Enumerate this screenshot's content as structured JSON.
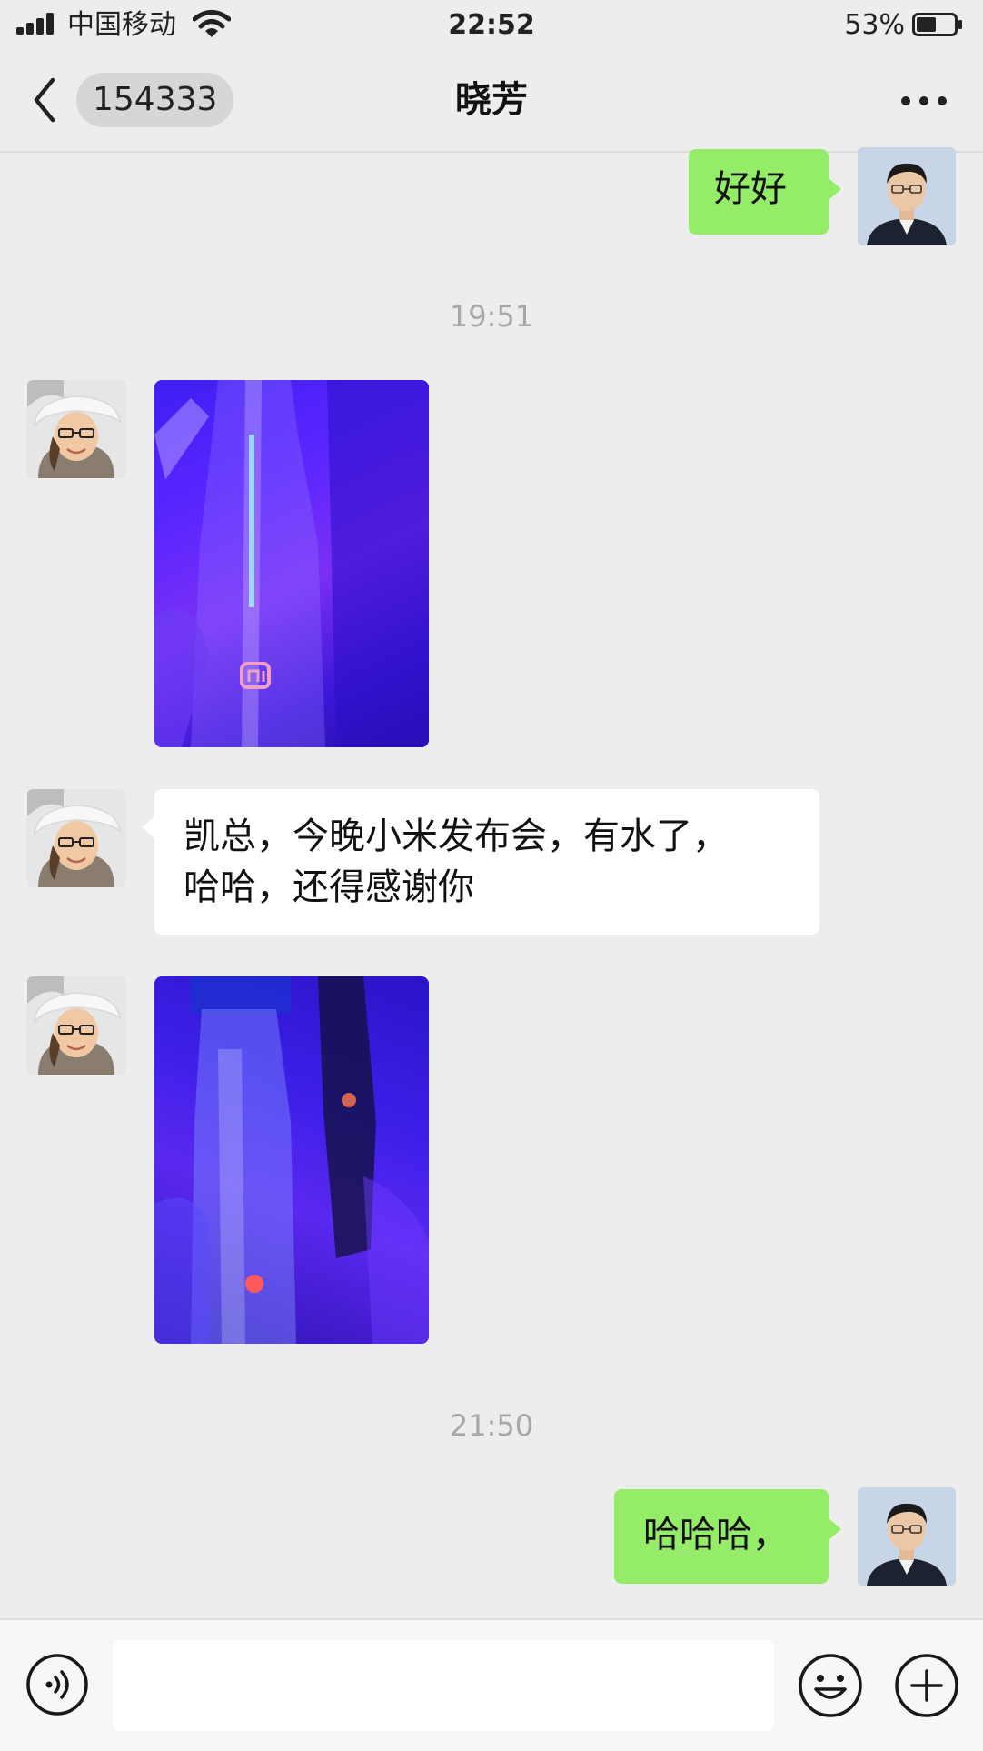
{
  "status_bar": {
    "carrier": "中国移动",
    "time": "22:52",
    "battery": "53%",
    "battery_level": 0.53
  },
  "nav": {
    "unread_count": "154333",
    "title": "晓芳"
  },
  "messages": {
    "m1": {
      "sender": "me",
      "text": "好好"
    },
    "t1": "19:51",
    "m2": {
      "sender": "other",
      "type": "image"
    },
    "m3": {
      "sender": "other",
      "line1": "凯总，今晚小米发布会，有水了，",
      "line2": "哈哈，还得感谢你"
    },
    "m4": {
      "sender": "other",
      "type": "image"
    },
    "t2": "21:50",
    "m5": {
      "sender": "me",
      "text": "哈哈哈，"
    }
  },
  "input_bar": {
    "value": "",
    "icons": [
      "voice-icon",
      "emoji-icon",
      "plus-icon"
    ]
  },
  "colors": {
    "background": "#ededed",
    "bubble_mine": "#95ec69",
    "bubble_theirs": "#ffffff",
    "timestamp": "#a7a7a7"
  }
}
